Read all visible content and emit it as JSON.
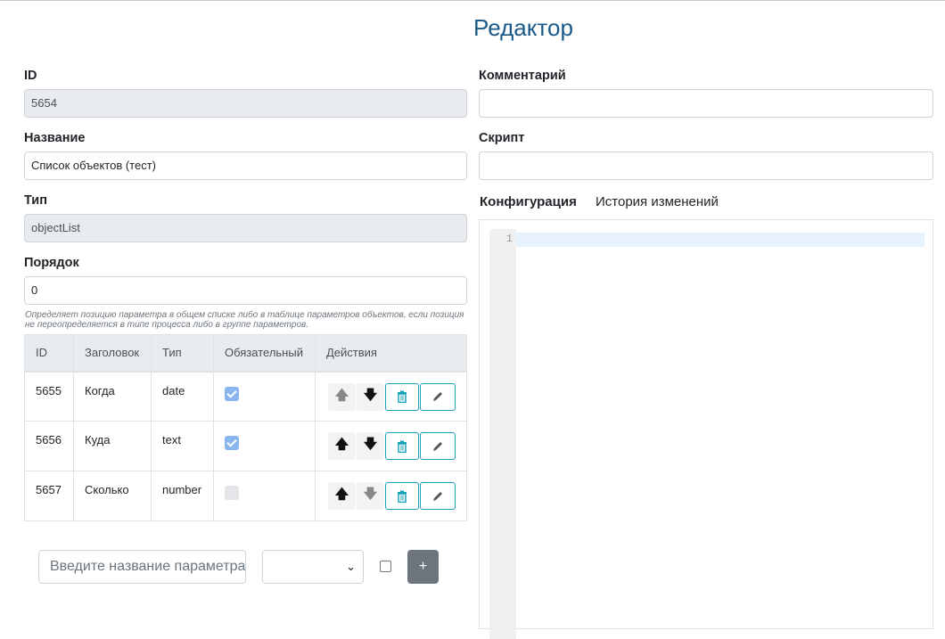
{
  "page": {
    "title": "Редактор"
  },
  "left": {
    "id": {
      "label": "ID",
      "value": "5654"
    },
    "name": {
      "label": "Название",
      "value": "Список объектов (тест)"
    },
    "type": {
      "label": "Тип",
      "value": "objectList"
    },
    "order": {
      "label": "Порядок",
      "value": "0",
      "help": "Определяет позицию параметра в общем списке либо в таблице параметров объектов, если позиция не переопределяется в типе процесса либо в группе параметров."
    },
    "table": {
      "headers": [
        "ID",
        "Заголовок",
        "Тип",
        "Обязательный",
        "Действия"
      ],
      "rows": [
        {
          "id": "5655",
          "title": "Когда",
          "type": "date",
          "required": true,
          "up_enabled": false,
          "down_enabled": true
        },
        {
          "id": "5656",
          "title": "Куда",
          "type": "text",
          "required": true,
          "up_enabled": true,
          "down_enabled": true
        },
        {
          "id": "5657",
          "title": "Сколько",
          "type": "number",
          "required": false,
          "up_enabled": true,
          "down_enabled": false
        }
      ]
    },
    "new_param": {
      "placeholder": "Введите название параметра",
      "type_selected": "",
      "required": false,
      "add_label": "+"
    }
  },
  "right": {
    "comment": {
      "label": "Комментарий",
      "value": ""
    },
    "script": {
      "label": "Скрипт",
      "value": ""
    },
    "tabs": [
      {
        "label": "Конфигурация",
        "active": true
      },
      {
        "label": "История изменений",
        "active": false
      }
    ],
    "editor": {
      "line_number": "1",
      "content": ""
    }
  },
  "icons": {
    "up": "arrow-up-icon",
    "down": "arrow-down-icon",
    "delete": "trash-icon",
    "edit": "pencil-icon",
    "select": "chevron-down-icon"
  },
  "colors": {
    "title": "#1a5a8a",
    "accent": "#17a2b8",
    "add_button": "#6c757d",
    "checkbox": "#8ab6f0"
  }
}
